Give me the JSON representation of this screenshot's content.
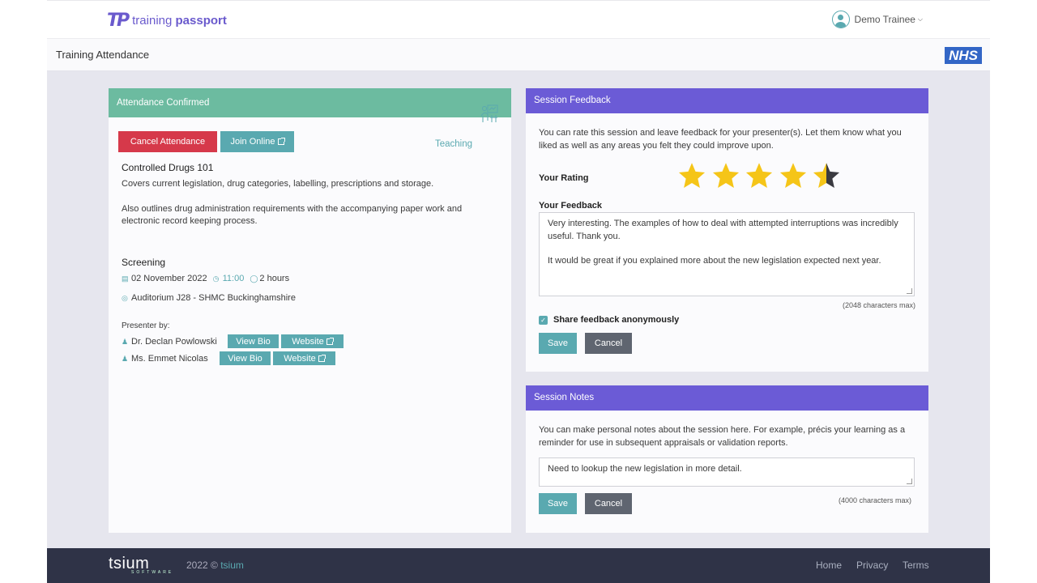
{
  "brand": {
    "logo_mark": "TP",
    "logo_word1": "training",
    "logo_word2": "passport"
  },
  "user": {
    "name": "Demo Trainee"
  },
  "page": {
    "title": "Training Attendance",
    "nhs_logo": "NHS"
  },
  "attendance": {
    "header": "Attendance Confirmed",
    "cancel_label": "Cancel Attendance",
    "join_label": "Join Online",
    "category": "Teaching",
    "course_title": "Controlled Drugs 101",
    "desc1": "Covers current legislation, drug categories, labelling, prescriptions and storage.",
    "desc2": "Also outlines drug administration requirements with the accompanying paper work and electronic record keeping process.",
    "session_type": "Screening",
    "date": "02 November 2022",
    "time": "11:00",
    "duration": "2 hours",
    "location": "Auditorium J28 - SHMC Buckinghamshire",
    "presenter_heading": "Presenter by:",
    "presenters": [
      {
        "name": "Dr. Declan Powlowski",
        "bio_label": "View Bio",
        "website_label": "Website"
      },
      {
        "name": "Ms. Emmet Nicolas",
        "bio_label": "View Bio",
        "website_label": "Website"
      }
    ]
  },
  "feedback": {
    "header": "Session Feedback",
    "intro": "You can rate this session and leave feedback for your presenter(s). Let them know what you liked as well as any areas you felt they could improve upon.",
    "rating_label": "Your Rating",
    "rating": 4.5,
    "rating_max": 5,
    "feedback_label": "Your Feedback",
    "feedback_line1": "Very interesting. The examples of how to deal with attempted interruptions was incredibly useful. Thank you.",
    "feedback_line2": "It would be great if you explained more about the new legislation expected next year.",
    "char_limit": "(2048 characters max)",
    "anon_label": "Share feedback anonymously",
    "anon_checked": true,
    "save_label": "Save",
    "cancel_label": "Cancel"
  },
  "notes": {
    "header": "Session Notes",
    "intro": "You can make personal notes about the session here. For example, précis your learning as a reminder for use in subsequent appraisals or validation reports.",
    "value": "Need to lookup the new legislation in more detail.",
    "char_limit": "(4000 characters max)",
    "save_label": "Save",
    "cancel_label": "Cancel"
  },
  "footer": {
    "logo": "tsium",
    "logo_sub": "SOFTWARE",
    "copyright": "2022 ©",
    "copyright_link": "tsium",
    "links": [
      "Home",
      "Privacy",
      "Terms"
    ]
  },
  "colors": {
    "accent_purple": "#6b5bd6",
    "accent_green": "#6cbba0",
    "teal": "#5aa9b0",
    "danger": "#d6394a",
    "star": "#f5c518"
  }
}
